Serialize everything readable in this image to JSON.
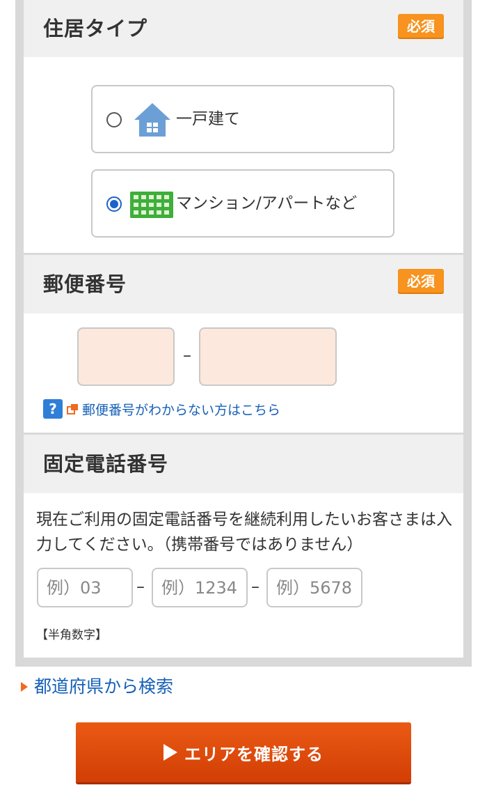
{
  "housing": {
    "title": "住居タイプ",
    "required": "必須",
    "options": [
      {
        "label": "一戸建て",
        "icon": "house-icon",
        "selected": false
      },
      {
        "label": "マンション/アパートなど",
        "icon": "apartment-icon",
        "selected": true
      }
    ]
  },
  "postal": {
    "title": "郵便番号",
    "required": "必須",
    "separator": "–",
    "first_value": "",
    "second_value": "",
    "help_link": "郵便番号がわからない方はこちら"
  },
  "phone": {
    "title": "固定電話番号",
    "description": "現在ご利用の固定電話番号を継続利用したいお客さまは入力してください。（携帯番号ではありません）",
    "placeholders": [
      "例）03",
      "例）1234",
      "例）5678"
    ],
    "separator": "–",
    "note": "【半角数字】"
  },
  "prefecture_link": "都道府県から検索",
  "cta_label": "エリアを確認する",
  "colors": {
    "required_badge": "#f7931e",
    "cta": "#e04e0c",
    "link": "#1660b8",
    "radio_selected": "#1a63c9",
    "zip_input_bg": "#fde8dd"
  }
}
